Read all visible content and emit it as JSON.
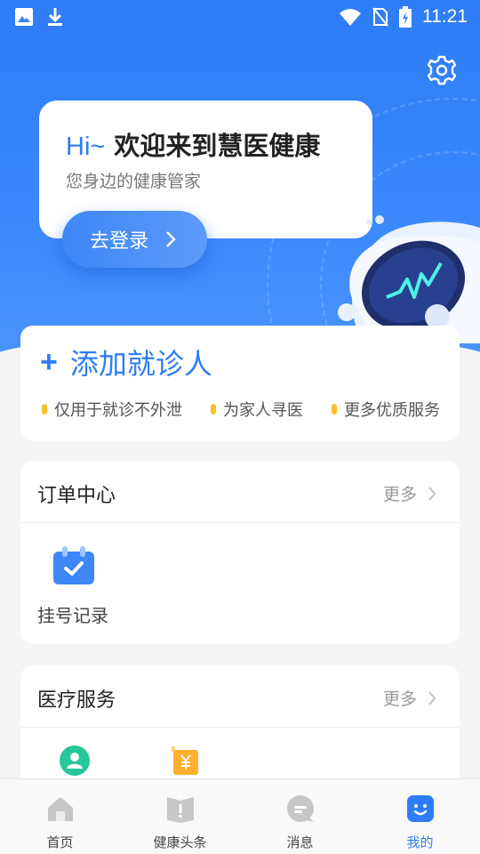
{
  "status_bar": {
    "time": "11:21",
    "icons": [
      "image-icon",
      "download-icon",
      "wifi-icon",
      "no-sim-icon",
      "battery-charging-icon"
    ]
  },
  "header": {
    "settings_icon": "gear-icon",
    "greeting_prefix": "Hi~",
    "greeting_main": "欢迎来到慧医健康",
    "subtitle": "您身边的健康管家",
    "login_label": "去登录"
  },
  "add_patient": {
    "plus": "+",
    "label": "添加就诊人",
    "perks": [
      "仅用于就诊不外泄",
      "为家人寻医",
      "更多优质服务"
    ]
  },
  "order_center": {
    "title": "订单中心",
    "more": "更多",
    "items": [
      {
        "label": "挂号记录",
        "icon": "calendar-check-icon"
      }
    ]
  },
  "medical_service": {
    "title": "医疗服务",
    "more": "更多",
    "items": [
      {
        "icon": "user-circle-icon"
      },
      {
        "icon": "yuan-receipt-icon"
      }
    ]
  },
  "bottom_nav": {
    "active": "我的",
    "items": [
      {
        "label": "首页",
        "icon": "home-icon"
      },
      {
        "label": "健康头条",
        "icon": "news-icon"
      },
      {
        "label": "消息",
        "icon": "message-icon"
      },
      {
        "label": "我的",
        "icon": "profile-icon"
      }
    ]
  },
  "colors": {
    "primary": "#2f7df6",
    "accent_dot": "#ffbe2e",
    "teal": "#27c79b",
    "amber": "#ffb02e"
  }
}
